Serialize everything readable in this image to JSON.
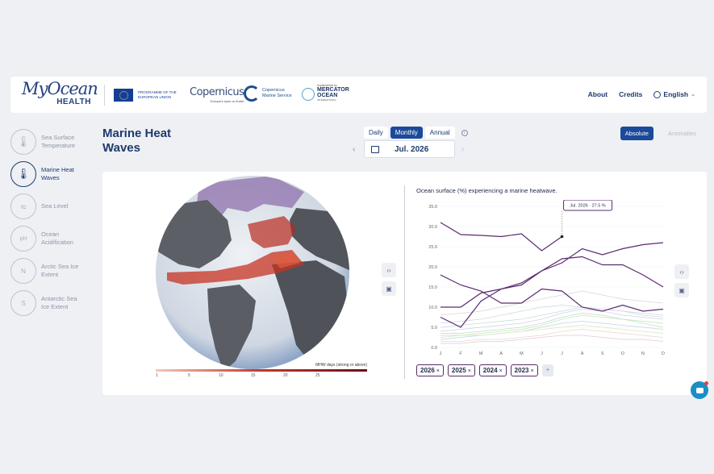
{
  "brand": {
    "name_top": "MyOcean",
    "name_bottom": "HEALTH"
  },
  "partners": {
    "eu": "PROGRAMME OF THE EUROPEAN UNION",
    "copernicus": "Copernicus",
    "copernicus_tagline": "Europe's eyes on Earth",
    "cms": "Copernicus Marine Service",
    "mercator_implemented": "Implemented by",
    "mercator_name": "MERCATOR OCEAN",
    "mercator_intl": "INTERNATIONAL"
  },
  "nav": {
    "about": "About",
    "credits": "Credits",
    "language": "English"
  },
  "sidebar": {
    "items": [
      {
        "label": "Sea Surface Temperature",
        "icon": "thermometer-icon",
        "active": false
      },
      {
        "label": "Marine Heat Waves",
        "icon": "heatwave-thermometer-icon",
        "active": true
      },
      {
        "label": "Sea Level",
        "icon": "sea-level-icon",
        "active": false
      },
      {
        "label": "Ocean Acidification",
        "icon": "ph-icon",
        "active": false
      },
      {
        "label": "Arctic Sea Ice Extent",
        "icon": "arctic-ice-icon",
        "active": false
      },
      {
        "label": "Antarctic Sea Ice Extent",
        "icon": "antarctic-ice-icon",
        "active": false
      }
    ]
  },
  "page": {
    "title": "Marine Heat Waves"
  },
  "frequency": {
    "daily": "Daily",
    "monthly": "Monthly",
    "annual": "Annual",
    "selected": "Monthly"
  },
  "date": {
    "value": "Jul. 2026"
  },
  "mode": {
    "absolute": "Absolute",
    "anomalies": "Anomalies",
    "selected": "Absolute"
  },
  "colorbar": {
    "unit": "MHW days (strong or above)",
    "ticks": [
      "1",
      "5",
      "10",
      "15",
      "20",
      "25"
    ]
  },
  "chart_data": {
    "type": "line",
    "title": "Ocean surface (%) experiencing a marine heatwave.",
    "categories": [
      "J",
      "F",
      "M",
      "A",
      "M",
      "J",
      "J",
      "A",
      "S",
      "O",
      "N",
      "D"
    ],
    "y_ticks": [
      "0.0",
      "5.0",
      "10.0",
      "15.0",
      "20.0",
      "25.0",
      "30.0",
      "35.0"
    ],
    "ylim": [
      0,
      35
    ],
    "tooltip": "Jul. 2026 · 27.5 %",
    "highlight_color": "#5b2a6e",
    "series": [
      {
        "name": "2026",
        "values": [
          31,
          28,
          27.8,
          27.5,
          28.2,
          24,
          27.5
        ]
      },
      {
        "name": "2025",
        "values": [
          18,
          15.5,
          14,
          11,
          11,
          14.5,
          14,
          10,
          9,
          10.5,
          9,
          9.5
        ]
      },
      {
        "name": "2024",
        "values": [
          10,
          10,
          13.5,
          14.5,
          15.5,
          19,
          22,
          22.5,
          20.5,
          20.5,
          18,
          15
        ]
      },
      {
        "name": "2023",
        "values": [
          7.5,
          5,
          11.5,
          14.5,
          16,
          19,
          21,
          24.5,
          23,
          24.5,
          25.5,
          26
        ]
      }
    ],
    "background_series": [
      [
        2,
        2.5,
        3,
        3.5,
        4,
        5,
        6,
        6.5,
        6,
        5.5,
        5,
        4.5
      ],
      [
        3,
        3,
        3.5,
        4,
        4.5,
        5.5,
        7,
        8,
        7.5,
        7,
        6,
        5
      ],
      [
        4,
        4.5,
        5,
        5.5,
        6,
        7,
        8.5,
        9.5,
        9,
        8,
        7.5,
        7
      ],
      [
        1.5,
        1.5,
        2,
        2,
        2.5,
        3,
        4,
        4.5,
        4,
        3.5,
        3,
        2.5
      ],
      [
        5,
        5.5,
        6,
        6.5,
        7,
        8,
        9,
        10,
        9.5,
        9,
        8,
        7.5
      ],
      [
        2.5,
        3,
        3,
        3.5,
        4,
        4.5,
        5,
        5.5,
        5,
        4.5,
        4,
        3.5
      ],
      [
        6,
        6.5,
        7,
        8,
        9,
        10,
        10.5,
        10,
        9.5,
        9,
        8.5,
        8
      ],
      [
        1,
        1,
        1.5,
        1.5,
        2,
        2.5,
        3,
        3,
        2.5,
        2,
        2,
        1.5
      ],
      [
        3.5,
        3.5,
        4,
        4.5,
        5,
        6,
        7.5,
        8.5,
        8,
        7,
        6.5,
        6
      ],
      [
        8,
        8.5,
        9,
        10,
        11,
        12,
        13,
        14,
        13,
        12,
        11.5,
        11
      ]
    ]
  },
  "year_chips": {
    "items": [
      "2026",
      "2025",
      "2024",
      "2023"
    ],
    "add": "+"
  }
}
